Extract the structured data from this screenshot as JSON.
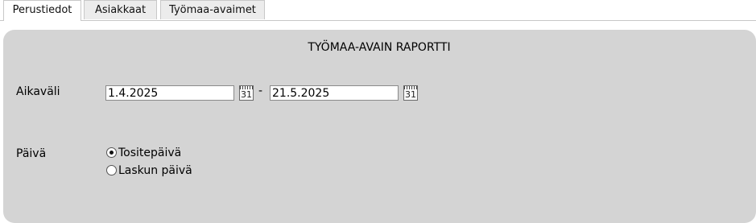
{
  "tabs": [
    {
      "label": "Perustiedot",
      "active": true
    },
    {
      "label": "Asiakkaat",
      "active": false
    },
    {
      "label": "Työmaa-avaimet",
      "active": false
    }
  ],
  "panel": {
    "title": "TYÖMAA-AVAIN RAPORTTI",
    "date_range": {
      "label": "Aikaväli",
      "start": "1.4.2025",
      "end": "21.5.2025",
      "separator": "-",
      "calendar_icon_text": "31"
    },
    "day": {
      "label": "Päivä",
      "options": [
        {
          "label": "Tositepäivä",
          "selected": true
        },
        {
          "label": "Laskun päivä",
          "selected": false
        }
      ]
    }
  },
  "colors": {
    "panel_background": "#d4d4d4",
    "tab_inactive": "#ececec",
    "tab_active": "#ffffff"
  }
}
